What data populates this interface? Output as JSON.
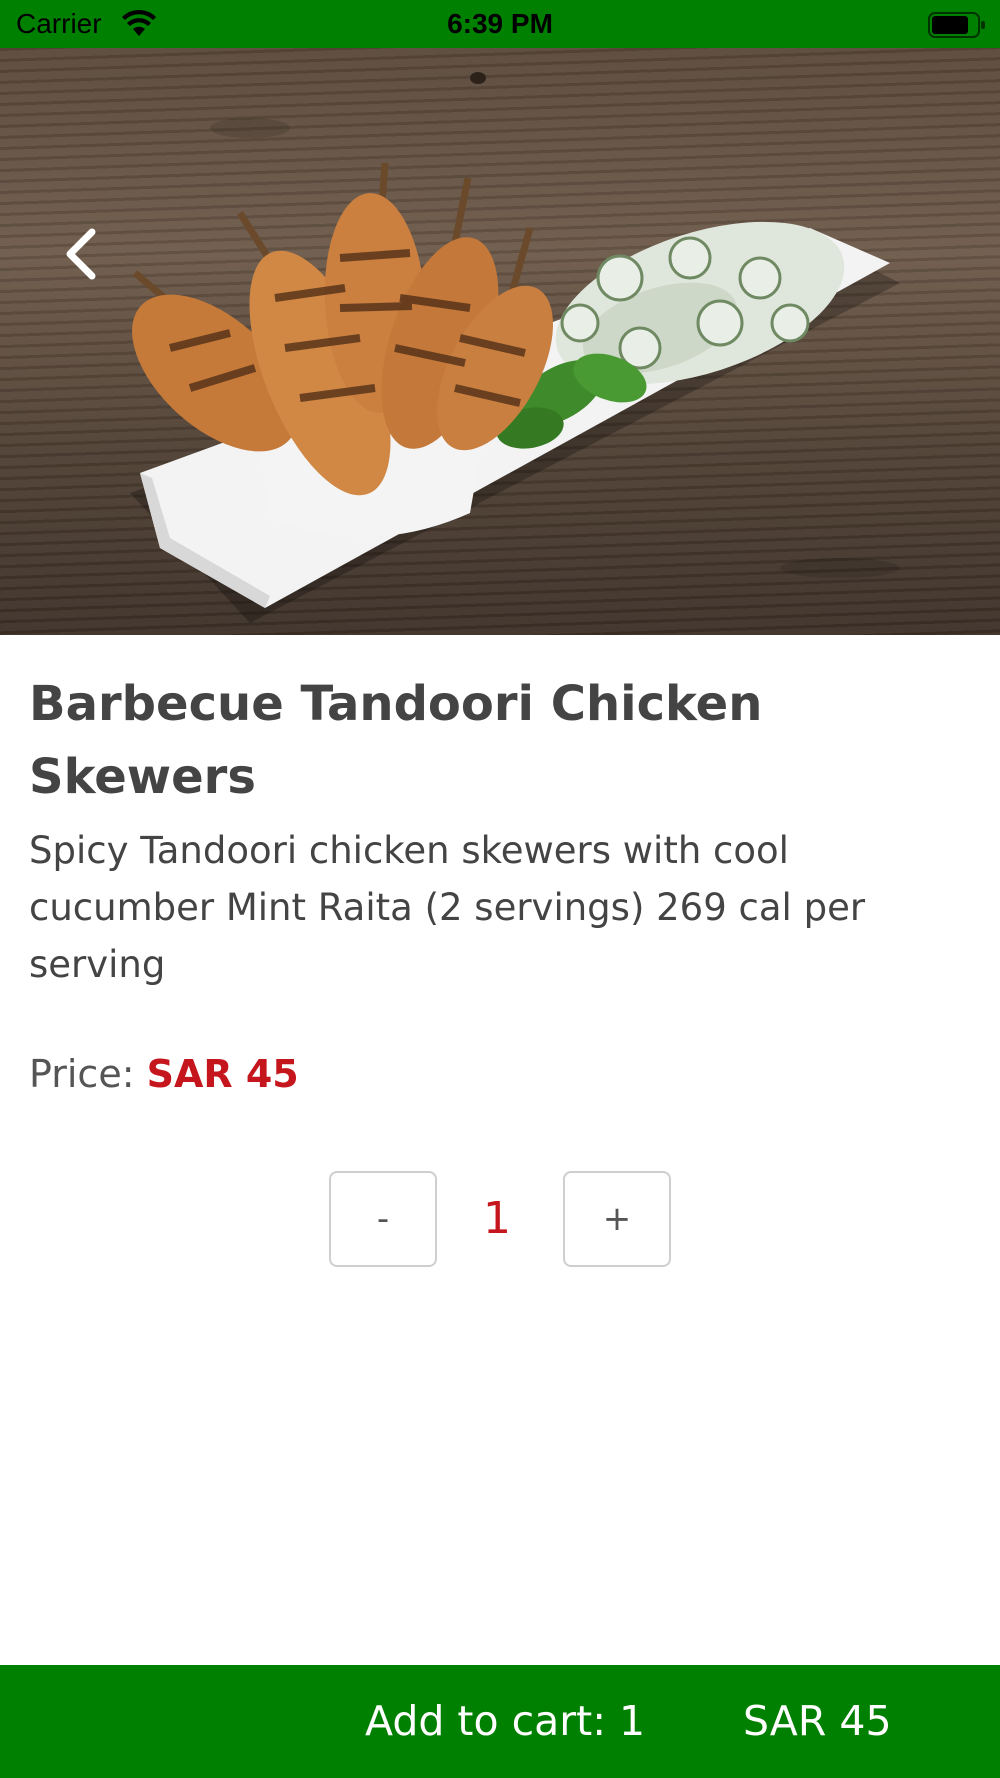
{
  "status_bar": {
    "carrier": "Carrier",
    "time": "6:39 PM",
    "icons": [
      "wifi-icon",
      "battery-icon"
    ]
  },
  "hero": {
    "image_description_icon": "food-photo",
    "back_icon": "chevron-left-icon"
  },
  "product": {
    "title": "Barbecue Tandoori Chicken Skewers",
    "description": "Spicy Tandoori chicken skewers with cool cucumber Mint Raita (2 servings) 269 cal per serving",
    "price_label": "Price: ",
    "price_value": "SAR 45"
  },
  "quantity": {
    "minus_label": "-",
    "value": "1",
    "plus_label": "+"
  },
  "cart_bar": {
    "add_label": "Add to cart: 1",
    "total": "SAR 45"
  },
  "colors": {
    "brand_green": "#008000",
    "price_red": "#c4161c",
    "text_gray": "#444444"
  }
}
